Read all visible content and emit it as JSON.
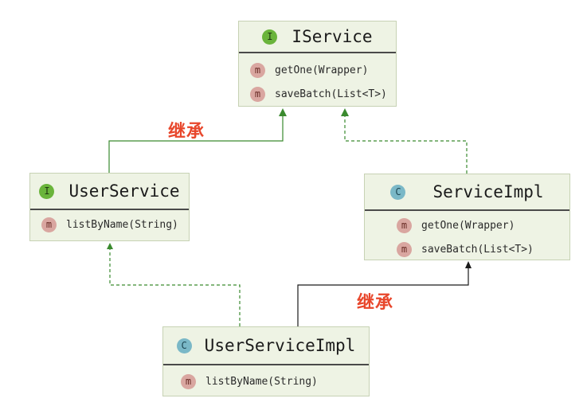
{
  "classes": {
    "iservice": {
      "kind_badge": "I",
      "name": "IService",
      "methods": [
        {
          "badge": "m",
          "name": "getOne(Wrapper)"
        },
        {
          "badge": "m",
          "name": "saveBatch(List<T>)"
        }
      ]
    },
    "userservice": {
      "kind_badge": "I",
      "name": "UserService",
      "methods": [
        {
          "badge": "m",
          "name": "listByName(String)"
        }
      ]
    },
    "serviceimpl": {
      "kind_badge": "C",
      "name": "ServiceImpl",
      "methods": [
        {
          "badge": "m",
          "name": "getOne(Wrapper)"
        },
        {
          "badge": "m",
          "name": "saveBatch(List<T>)"
        }
      ]
    },
    "userserviceimpl": {
      "kind_badge": "C",
      "name": "UserServiceImpl",
      "methods": [
        {
          "badge": "m",
          "name": "listByName(String)"
        }
      ]
    }
  },
  "relations": {
    "userservice_extends_iservice": {
      "label": "继承",
      "style": "solid",
      "color": "#3a8a2e"
    },
    "serviceimpl_implements_iservice": {
      "style": "dashed",
      "color": "#3a8a2e"
    },
    "userserviceimpl_implements_userservice": {
      "style": "dashed",
      "color": "#3a8a2e"
    },
    "userserviceimpl_extends_serviceimpl": {
      "label": "继承",
      "style": "solid",
      "color": "#1a1a1a"
    }
  },
  "colors": {
    "box_fill": "#eef3e4",
    "interface_badge": "#6ab43b",
    "class_badge": "#7ab8c7",
    "method_badge": "#d9a6a0",
    "label_red": "#e8472c"
  }
}
